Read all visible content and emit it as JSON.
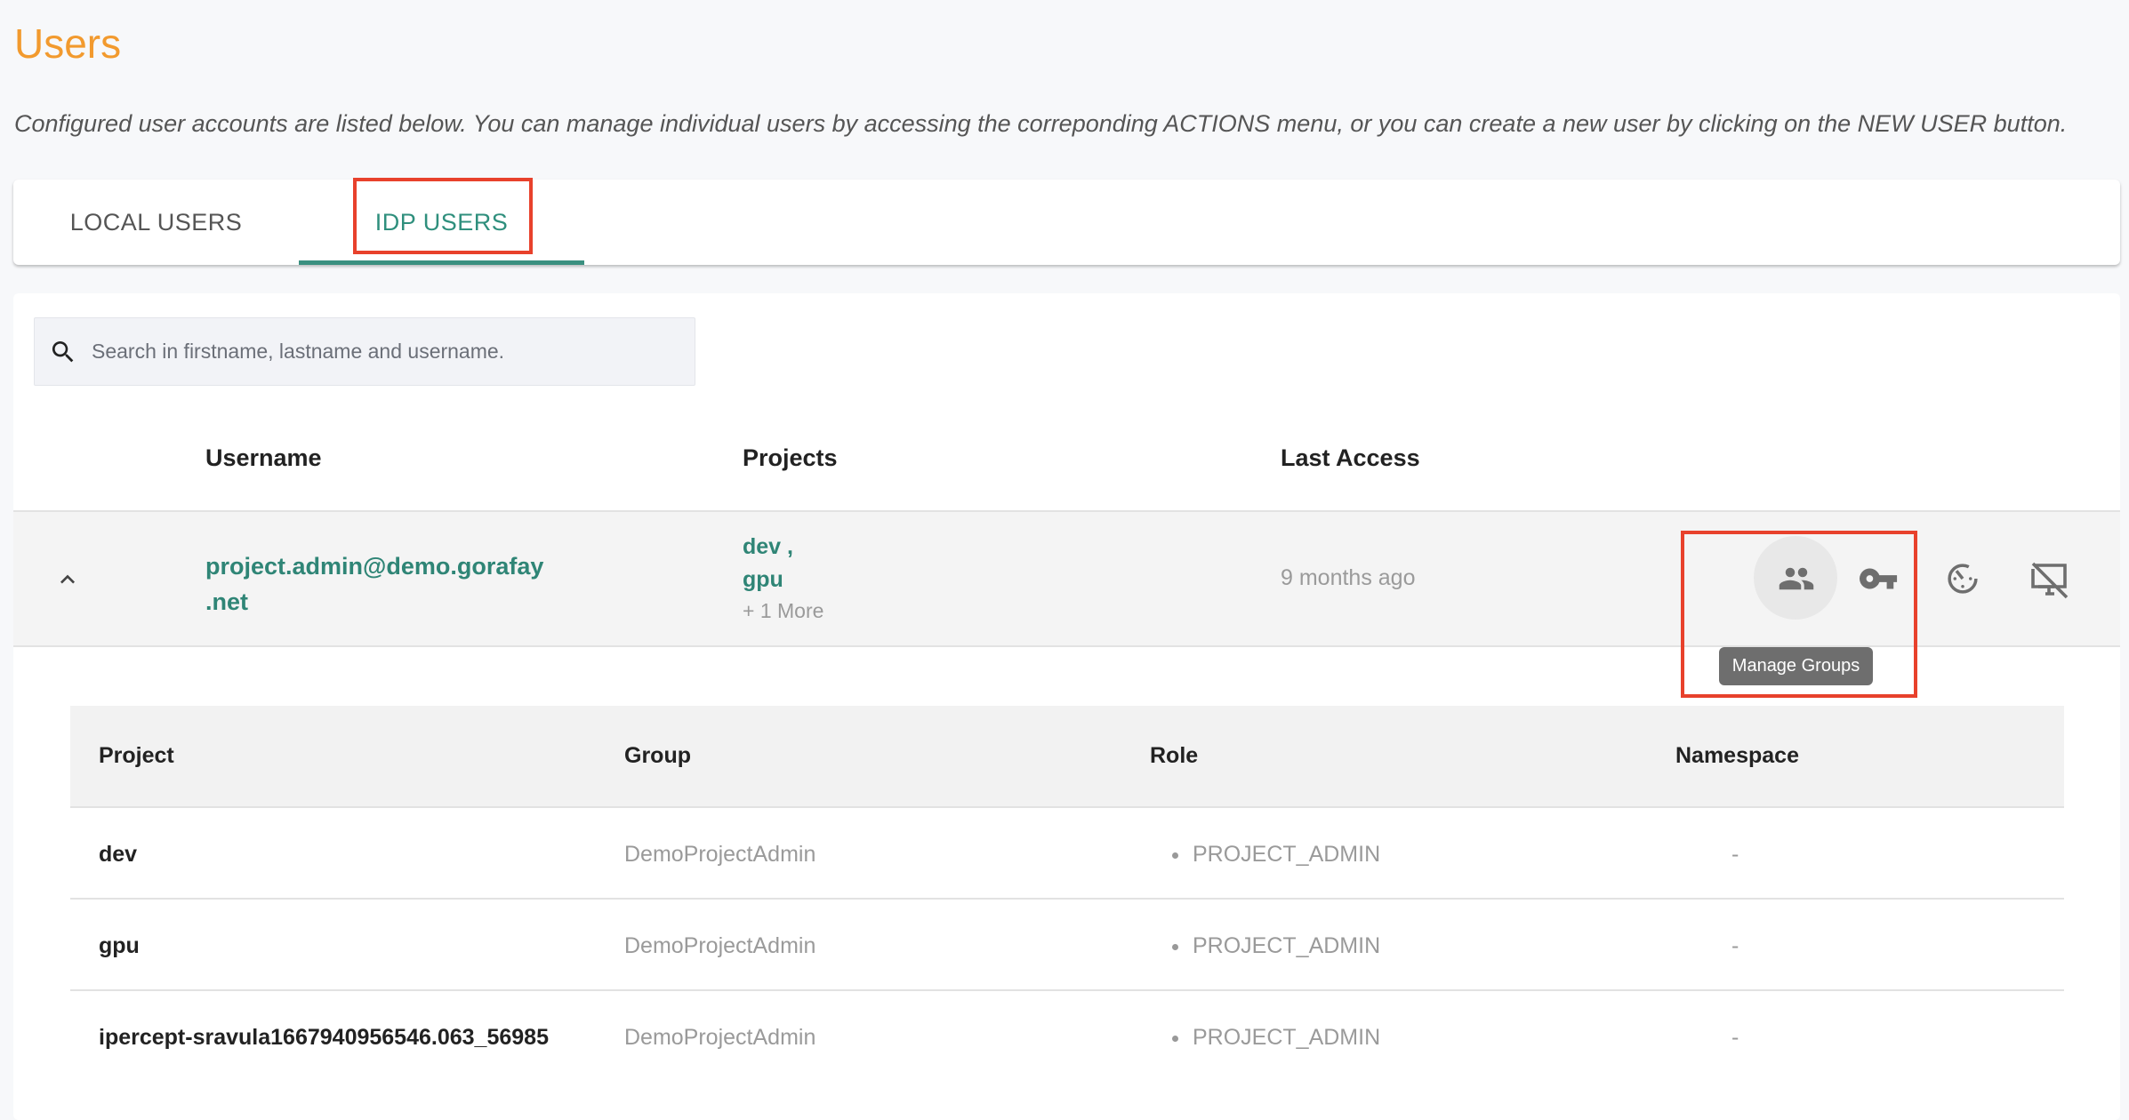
{
  "page": {
    "title": "Users",
    "description": "Configured user accounts are listed below. You can manage individual users by accessing the correponding ACTIONS menu, or you can create a new user by clicking on the NEW USER button."
  },
  "tabs": [
    {
      "label": "LOCAL USERS",
      "active": false
    },
    {
      "label": "IDP USERS",
      "active": true
    }
  ],
  "search": {
    "placeholder": "Search in firstname, lastname and username.",
    "value": ""
  },
  "table": {
    "headers": {
      "username": "Username",
      "projects": "Projects",
      "last_access": "Last Access"
    },
    "rows": [
      {
        "username": "project.admin@demo.gorafay.net",
        "username_line1": "project.admin@demo.gorafay",
        "username_line2": ".net",
        "projects": [
          "dev ,",
          "gpu"
        ],
        "more": "+ 1 More",
        "last_access": "9 months ago",
        "expanded": true
      }
    ]
  },
  "actions": {
    "icons": [
      "manage-groups-icon",
      "key-icon",
      "timer-icon",
      "monitor-off-icon"
    ],
    "tooltip": "Manage Groups"
  },
  "subtable": {
    "headers": [
      "Project",
      "Group",
      "Role",
      "Namespace"
    ],
    "rows": [
      {
        "project": "dev",
        "group": "DemoProjectAdmin",
        "role": "PROJECT_ADMIN",
        "namespace": "-"
      },
      {
        "project": "gpu",
        "group": "DemoProjectAdmin",
        "role": "PROJECT_ADMIN",
        "namespace": "-"
      },
      {
        "project": "ipercept-sravula1667940956546.063_56985",
        "group": "DemoProjectAdmin",
        "role": "PROJECT_ADMIN",
        "namespace": "-"
      }
    ]
  },
  "colors": {
    "title": "#f29a2e",
    "accent": "#3a9080",
    "highlight": "#e8412c"
  }
}
